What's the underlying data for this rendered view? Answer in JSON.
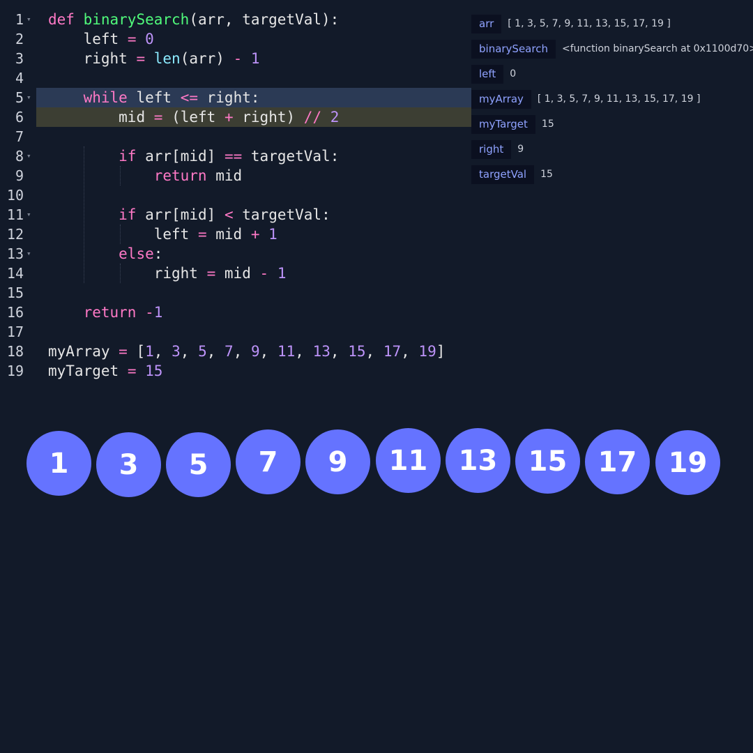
{
  "code_lines": [
    "def binarySearch(arr, targetVal):",
    "    left = 0",
    "    right = len(arr) - 1",
    "",
    "    while left <= right:",
    "        mid = (left + right) // 2",
    "",
    "        if arr[mid] == targetVal:",
    "            return mid",
    "",
    "        if arr[mid] < targetVal:",
    "            left = mid + 1",
    "        else:",
    "            right = mid - 1",
    "",
    "    return -1",
    "",
    "myArray = [1, 3, 5, 7, 9, 11, 13, 15, 17, 19]",
    "myTarget = 15"
  ],
  "line_numbers": [
    "1",
    "2",
    "3",
    "4",
    "5",
    "6",
    "7",
    "8",
    "9",
    "10",
    "11",
    "12",
    "13",
    "14",
    "15",
    "16",
    "17",
    "18",
    "19"
  ],
  "variables": [
    {
      "name": "arr",
      "value": "[ 1, 3, 5, 7, 9, 11, 13, 15, 17, 19 ]"
    },
    {
      "name": "binarySearch",
      "value": "<function binarySearch at 0x1100d70>"
    },
    {
      "name": "left",
      "value": "0"
    },
    {
      "name": "myArray",
      "value": "[ 1, 3, 5, 7, 9, 11, 13, 15, 17, 19 ]"
    },
    {
      "name": "myTarget",
      "value": "15"
    },
    {
      "name": "right",
      "value": "9"
    },
    {
      "name": "targetVal",
      "value": "15"
    }
  ],
  "array_values": [
    "1",
    "3",
    "5",
    "7",
    "9",
    "11",
    "13",
    "15",
    "17",
    "19"
  ],
  "colors": {
    "background": "#121a29",
    "circle": "#6573ff",
    "highlight_while": "#2b3a55",
    "highlight_mid": "#3c3e33",
    "var_name_text": "#8fa2ff"
  }
}
